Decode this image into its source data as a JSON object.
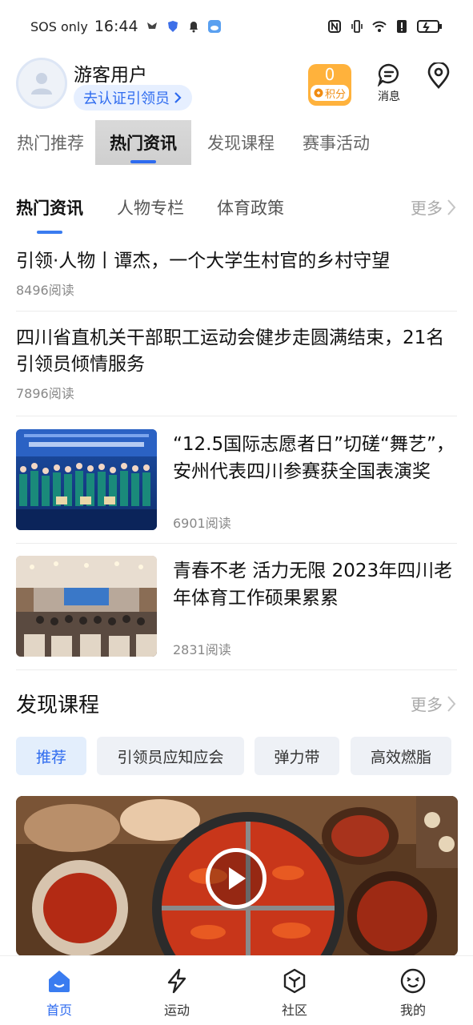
{
  "status_bar": {
    "carrier": "SOS only",
    "time": "16:44"
  },
  "header": {
    "username": "游客用户",
    "verify_label": "去认证引领员",
    "points_value": "0",
    "points_label": "积分",
    "messages_label": "消息"
  },
  "main_tabs": [
    {
      "label": "热门推荐"
    },
    {
      "label": "热门资讯"
    },
    {
      "label": "发现课程"
    },
    {
      "label": "赛事活动"
    }
  ],
  "news_tabs": [
    {
      "label": "热门资讯"
    },
    {
      "label": "人物专栏"
    },
    {
      "label": "体育政策"
    }
  ],
  "more_label": "更多",
  "news": [
    {
      "title": "引领·人物丨谭杰，一个大学生村官的乡村守望",
      "reads": "8496阅读"
    },
    {
      "title": "四川省直机关干部职工运动会健步走圆满结束，21名引领员倾情服务",
      "reads": "7896阅读"
    },
    {
      "title": "“12.5国际志愿者日”切磋“舞艺”，安州代表四川参赛获全国表演奖",
      "reads": "6901阅读",
      "image": "group-performance-photo"
    },
    {
      "title": "青春不老 活力无限 2023年四川老年体育工作硕果累累",
      "reads": "2831阅读",
      "image": "conference-hall-photo"
    }
  ],
  "courses": {
    "title": "发现课程",
    "more_label": "更多",
    "chips": [
      {
        "label": "推荐"
      },
      {
        "label": "引领员应知应会"
      },
      {
        "label": "弹力带"
      },
      {
        "label": "高效燃脂"
      }
    ],
    "video_image": "hotpot-food-photo"
  },
  "bottom_nav": [
    {
      "label": "首页",
      "icon": "home-icon"
    },
    {
      "label": "运动",
      "icon": "lightning-icon"
    },
    {
      "label": "社区",
      "icon": "community-icon"
    },
    {
      "label": "我的",
      "icon": "profile-face-icon"
    }
  ],
  "colors": {
    "accent": "#2e6bef",
    "points": "#ffb23c"
  }
}
